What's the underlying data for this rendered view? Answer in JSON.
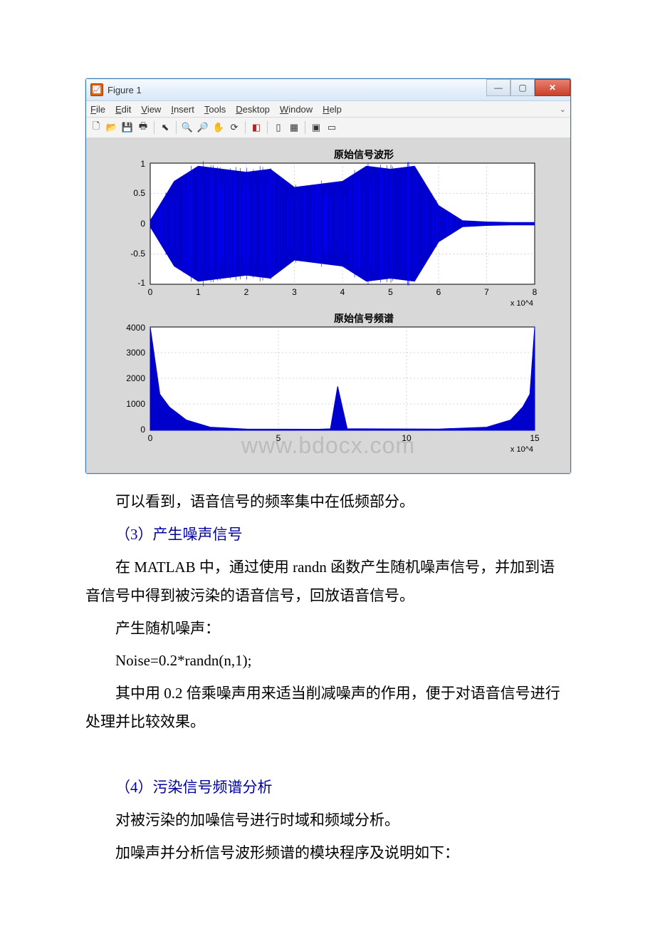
{
  "figure_window": {
    "title": "Figure 1",
    "menu": [
      "File",
      "Edit",
      "View",
      "Insert",
      "Tools",
      "Desktop",
      "Window",
      "Help"
    ],
    "toolbar_icons": [
      "new-file-icon",
      "open-icon",
      "save-icon",
      "print-icon",
      "sep",
      "pointer-icon",
      "zoom-in-icon",
      "zoom-out-icon",
      "pan-icon",
      "rotate-icon",
      "sep",
      "data-cursor-icon",
      "sep",
      "link-icon",
      "colorbar-icon",
      "sep",
      "legend-icon",
      "sep2-icon"
    ],
    "watermark": "www.bdocx.com"
  },
  "chart_data": [
    {
      "type": "line",
      "title": "原始信号波形",
      "xlabel": "",
      "ylabel": "",
      "xlim": [
        0,
        80000
      ],
      "ylim": [
        -1,
        1
      ],
      "x_ticks": [
        0,
        1,
        2,
        3,
        4,
        5,
        6,
        7,
        8
      ],
      "x_tick_scale_label": "x 10^4",
      "y_ticks": [
        -1,
        -0.5,
        0,
        0.5,
        1
      ],
      "description": "Dense audio waveform (speech signal), amplitude mostly fills −1..1 from ~5000 to ~60000, then quiet tail",
      "envelope_segments": [
        {
          "x": 0,
          "amp": 0.05
        },
        {
          "x": 5000,
          "amp": 0.7
        },
        {
          "x": 10000,
          "amp": 0.95
        },
        {
          "x": 15000,
          "amp": 0.9
        },
        {
          "x": 20000,
          "amp": 0.85
        },
        {
          "x": 25000,
          "amp": 0.9
        },
        {
          "x": 30000,
          "amp": 0.6
        },
        {
          "x": 35000,
          "amp": 0.65
        },
        {
          "x": 40000,
          "amp": 0.7
        },
        {
          "x": 45000,
          "amp": 0.95
        },
        {
          "x": 50000,
          "amp": 0.9
        },
        {
          "x": 55000,
          "amp": 0.95
        },
        {
          "x": 60000,
          "amp": 0.3
        },
        {
          "x": 65000,
          "amp": 0.05
        },
        {
          "x": 70000,
          "amp": 0.03
        },
        {
          "x": 75000,
          "amp": 0.02
        },
        {
          "x": 80000,
          "amp": 0.02
        }
      ]
    },
    {
      "type": "line",
      "title": "原始信号频谱",
      "xlabel": "",
      "ylabel": "",
      "xlim": [
        0,
        160000
      ],
      "ylim": [
        0,
        4000
      ],
      "x_ticks": [
        0,
        5,
        10,
        15
      ],
      "x_tick_scale_label": "x 10^4",
      "y_ticks": [
        0,
        1000,
        2000,
        3000,
        4000
      ],
      "description": "Magnitude spectrum; energy concentrated at low frequencies with symmetric mirror peak near upper end",
      "approx_points": [
        {
          "x": 0,
          "y": 4000
        },
        {
          "x": 4000,
          "y": 1400
        },
        {
          "x": 8000,
          "y": 900
        },
        {
          "x": 15000,
          "y": 400
        },
        {
          "x": 25000,
          "y": 120
        },
        {
          "x": 40000,
          "y": 50
        },
        {
          "x": 70000,
          "y": 40
        },
        {
          "x": 75000,
          "y": 60
        },
        {
          "x": 78000,
          "y": 1700
        },
        {
          "x": 82000,
          "y": 60
        },
        {
          "x": 120000,
          "y": 50
        },
        {
          "x": 140000,
          "y": 120
        },
        {
          "x": 150000,
          "y": 400
        },
        {
          "x": 155000,
          "y": 900
        },
        {
          "x": 158000,
          "y": 1400
        },
        {
          "x": 160000,
          "y": 4000
        }
      ]
    }
  ],
  "text": {
    "p1": "可以看到，语音信号的频率集中在低频部分。",
    "p2": "（3）产生噪声信号",
    "p3": "在 MATLAB 中，通过使用 randn 函数产生随机噪声信号，并加到语音信号中得到被污染的语音信号，回放语音信号。",
    "p4": "产生随机噪声：",
    "p5": "Noise=0.2*randn(n,1);",
    "p6": "其中用 0.2 倍乘噪声用来适当削减噪声的作用，便于对语音信号进行处理并比较效果。",
    "p7": "（4）污染信号频谱分析",
    "p8": "对被污染的加噪信号进行时域和频域分析。",
    "p9": "加噪声并分析信号波形频谱的模块程序及说明如下："
  }
}
